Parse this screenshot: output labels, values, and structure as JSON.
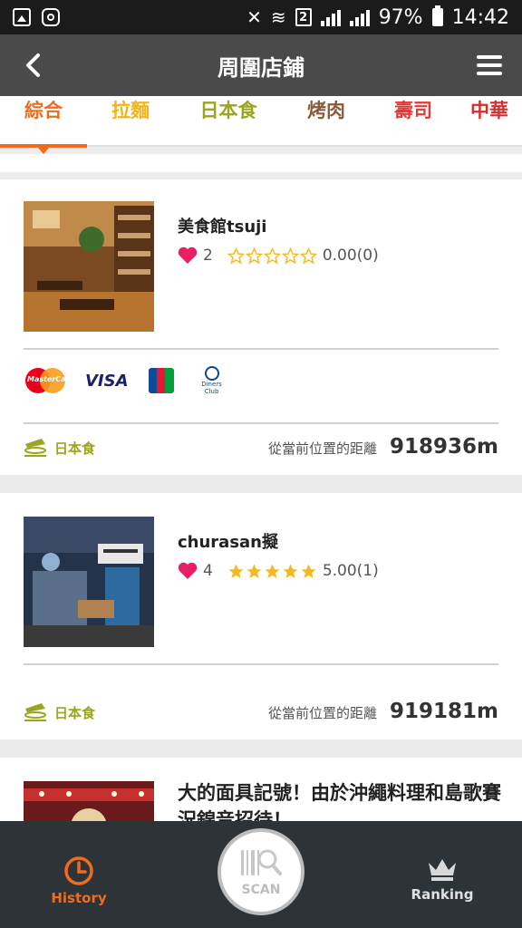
{
  "status_bar": {
    "battery": "97%",
    "time": "14:42",
    "sim_slot": "2"
  },
  "header": {
    "title": "周圍店鋪"
  },
  "tabs": [
    {
      "label": "綜合",
      "color": "#f26b1d",
      "active": true
    },
    {
      "label": "拉麵",
      "color": "#f4b41a",
      "active": false
    },
    {
      "label": "日本食",
      "color": "#9aa520",
      "active": false
    },
    {
      "label": "烤肉",
      "color": "#8a5a3a",
      "active": false
    },
    {
      "label": "壽司",
      "color": "#e53935",
      "active": false
    },
    {
      "label": "中華",
      "color": "#d32f2f",
      "active": false
    }
  ],
  "shops": [
    {
      "name": "美食館tsuji",
      "likes": "2",
      "stars_filled": 0,
      "rating": "0.00(0)",
      "payments": [
        "MasterCard",
        "VISA",
        "JCB",
        "Diners Club"
      ],
      "category": "日本食",
      "distance_label": "從當前位置的距離",
      "distance": "918936m"
    },
    {
      "name": "churasan擬",
      "likes": "4",
      "stars_filled": 5,
      "rating": "5.00(1)",
      "category": "日本食",
      "distance_label": "從當前位置的距離",
      "distance": "919181m"
    },
    {
      "name": "大的面具記號！由於沖繩料理和島歌賽況錦音招待！"
    }
  ],
  "bottom_nav": {
    "history": "History",
    "scan": "SCAN",
    "ranking": "Ranking"
  },
  "colors": {
    "accent": "#f26b1d",
    "heart": "#e91e63",
    "star": "#f5b820",
    "category": "#9aa520",
    "header_bg": "#4a4a4a"
  },
  "icons": {
    "back": "chevron-left-icon",
    "menu": "hamburger-menu-icon",
    "heart": "heart-icon",
    "star": "star-icon",
    "category": "food-dish-icon",
    "history": "clock-icon",
    "scan": "barcode-scan-icon",
    "ranking": "crown-icon"
  }
}
